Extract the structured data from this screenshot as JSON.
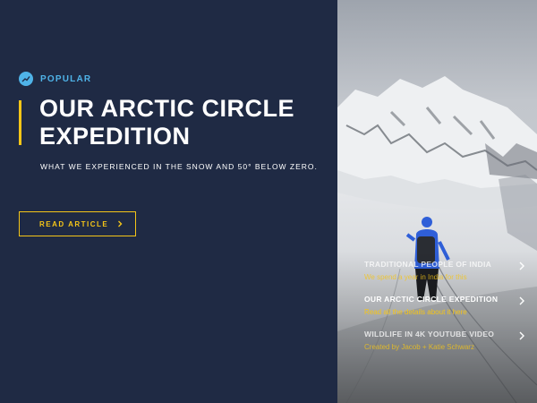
{
  "tag": {
    "icon": "trending-up-icon",
    "label": "POPULAR"
  },
  "hero": {
    "title_line1": "OUR ARCTIC CIRCLE",
    "title_line2": "EXPEDITION",
    "subtitle": "WHAT WE EXPERIENCED IN THE SNOW AND 50° BELOW ZERO."
  },
  "cta": {
    "label": "READ ARTICLE",
    "icon": "chevron-right-icon"
  },
  "stories": [
    {
      "title": "TRADITIONAL PEOPLE OF INDIA",
      "subtitle": "We spend a year in India for this"
    },
    {
      "title": "OUR ARCTIC CIRCLE EXPEDITION",
      "subtitle": "Read all the details about it here"
    },
    {
      "title": "WILDLIFE IN 4K YOUTUBE VIDEO",
      "subtitle": "Created by Jacob + Katie Schwarz"
    }
  ],
  "colors": {
    "background": "#1f2a44",
    "accent": "#f5c518",
    "tag": "#4fb3e8"
  }
}
